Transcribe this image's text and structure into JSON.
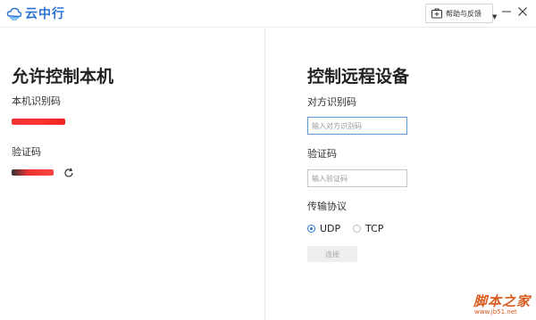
{
  "app": {
    "name": "云中行"
  },
  "titlebar": {
    "help_label": "帮助与反馈"
  },
  "local": {
    "heading": "允许控制本机",
    "id_label": "本机识别码",
    "code_label": "验证码"
  },
  "remote": {
    "heading": "控制远程设备",
    "peer_id_label": "对方识别码",
    "peer_id_placeholder": "输入对方识别码",
    "code_label": "验证码",
    "code_placeholder": "输入验证码",
    "protocol_label": "传输协议",
    "protocols": [
      {
        "label": "UDP",
        "selected": true
      },
      {
        "label": "TCP",
        "selected": false
      }
    ],
    "connect_label": "连接"
  },
  "watermark": {
    "title": "脚本之家",
    "url": "www.jb51.net"
  },
  "colors": {
    "accent": "#2b73d2",
    "redaction": "#e33333",
    "watermark": "#d85b1f"
  }
}
